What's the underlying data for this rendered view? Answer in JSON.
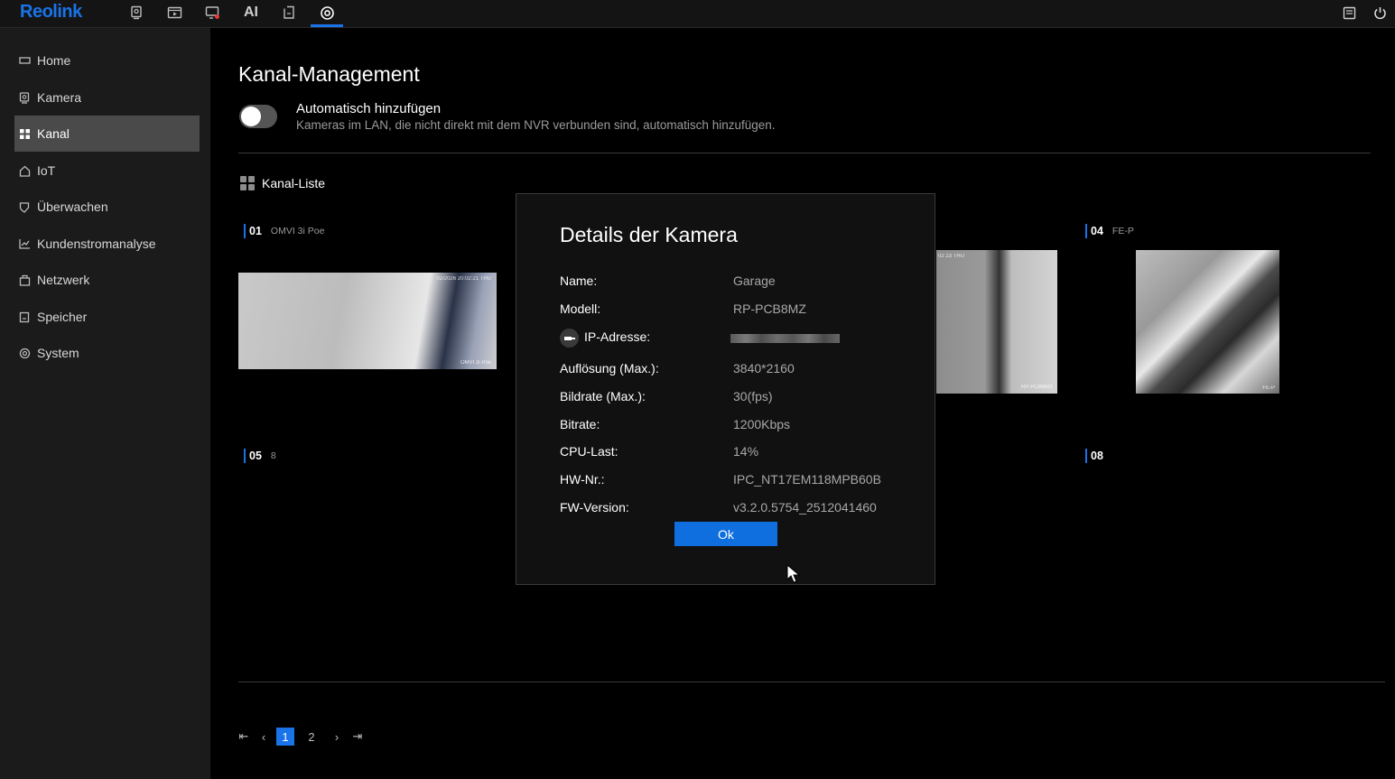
{
  "app": {
    "logo": "Reolink"
  },
  "topbar": {
    "icons": [
      "live-view-icon",
      "playback-icon",
      "alarm-icon",
      "ai-icon",
      "file-icon",
      "settings-icon"
    ],
    "ai_label": "AI",
    "right_icons": [
      "message-icon",
      "power-icon"
    ],
    "accent_color": "#1a73e8"
  },
  "sidebar": {
    "items": [
      {
        "label": "Home",
        "icon": "home-icon"
      },
      {
        "label": "Kamera",
        "icon": "camera-icon"
      },
      {
        "label": "Kanal",
        "icon": "channel-grid-icon",
        "active": true
      },
      {
        "label": "IoT",
        "icon": "iot-icon"
      },
      {
        "label": "Überwachen",
        "icon": "shield-icon"
      },
      {
        "label": "Kundenstromanalyse",
        "icon": "chart-icon"
      },
      {
        "label": "Netzwerk",
        "icon": "network-icon"
      },
      {
        "label": "Speicher",
        "icon": "storage-icon"
      },
      {
        "label": "System",
        "icon": "system-icon"
      }
    ]
  },
  "main": {
    "title": "Kanal-Management",
    "auto_add": {
      "title": "Automatisch hinzufügen",
      "description": "Kameras im LAN, die nicht direkt mit dem NVR verbunden sind, automatisch hinzufügen.",
      "enabled": false
    },
    "channel_list_title": "Kanal-Liste",
    "channels": [
      {
        "num": "01",
        "name": "OMVI 3i Poe"
      },
      {
        "num": "04",
        "name": "FE-P"
      },
      {
        "num": "05",
        "name": "8"
      },
      {
        "num": "08",
        "name": ""
      }
    ],
    "cam_overlays": {
      "cam1_ts": "02/2026 20:02:21 THU",
      "cam1_name": "OMVI 3i Poe",
      "cam3_ts": "02 23 THU",
      "cam3_name": "RP-PCB8MX",
      "cam4_name": "FE-P"
    }
  },
  "pagination": {
    "first": "⇤",
    "prev": "‹",
    "pages": [
      "1",
      "2"
    ],
    "current": "1",
    "next": "›",
    "last": "⇥"
  },
  "modal": {
    "title": "Details der Kamera",
    "rows": [
      {
        "label": "Name:",
        "value": "Garage"
      },
      {
        "label": "Modell:",
        "value": "RP-PCB8MZ"
      },
      {
        "label": "IP-Adresse:",
        "value": ""
      },
      {
        "label": "Auflösung (Max.):",
        "value": "3840*2160"
      },
      {
        "label": "Bildrate (Max.):",
        "value": "30(fps)"
      },
      {
        "label": "Bitrate:",
        "value": "1200Kbps"
      },
      {
        "label": "CPU-Last:",
        "value": "14%"
      },
      {
        "label": "HW-Nr.:",
        "value": "IPC_NT17EM118MPB60B"
      },
      {
        "label": "FW-Version:",
        "value": "v3.2.0.5754_2512041460"
      }
    ],
    "ok_label": "Ok"
  }
}
